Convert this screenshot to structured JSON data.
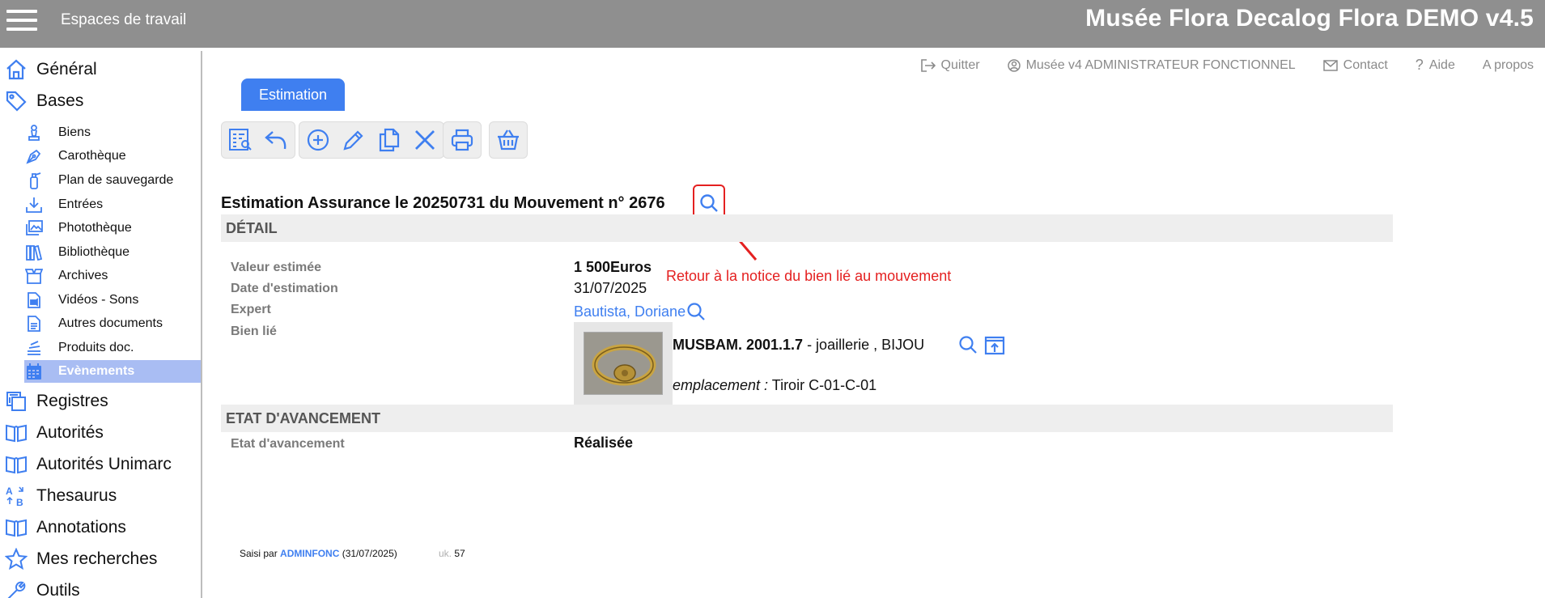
{
  "header": {
    "workspaces_label": "Espaces de travail",
    "app_title": "Musée Flora Decalog Flora DEMO v4.5"
  },
  "sidebar": {
    "main_top": [
      {
        "label": "Général",
        "icon": "home-icon"
      },
      {
        "label": "Bases",
        "icon": "tag-icon"
      }
    ],
    "sub_items": [
      {
        "label": "Biens",
        "icon": "statue-icon"
      },
      {
        "label": "Carothèque",
        "icon": "pen-nib-icon"
      },
      {
        "label": "Plan de sauvegarde",
        "icon": "fire-extinguisher-icon"
      },
      {
        "label": "Entrées",
        "icon": "download-icon"
      },
      {
        "label": "Photothèque",
        "icon": "images-icon"
      },
      {
        "label": "Bibliothèque",
        "icon": "books-icon"
      },
      {
        "label": "Archives",
        "icon": "box-open-icon"
      },
      {
        "label": "Vidéos - Sons",
        "icon": "file-video-icon"
      },
      {
        "label": "Autres documents",
        "icon": "file-text-icon"
      },
      {
        "label": "Produits doc.",
        "icon": "stack-icon"
      },
      {
        "label": "Evènements",
        "icon": "calendar-icon",
        "active": true
      }
    ],
    "main_bottom": [
      {
        "label": "Registres",
        "icon": "copy-icon"
      },
      {
        "label": "Autorités",
        "icon": "book-open-icon"
      },
      {
        "label": "Autorités Unimarc",
        "icon": "book-open-icon"
      },
      {
        "label": "Thesaurus",
        "icon": "sort-alpha-icon"
      },
      {
        "label": "Annotations",
        "icon": "book-open-icon"
      },
      {
        "label": "Mes recherches",
        "icon": "star-icon"
      },
      {
        "label": "Outils",
        "icon": "wrench-icon"
      }
    ]
  },
  "toplinks": {
    "quit": "Quitter",
    "user": "Musée v4 ADMINISTRATEUR FONCTIONNEL",
    "contact": "Contact",
    "help": "Aide",
    "about": "A propos"
  },
  "tab": {
    "label": "Estimation"
  },
  "record": {
    "title": "Estimation Assurance le 20250731 du Mouvement n° 2676"
  },
  "sections": {
    "detail": "DÉTAIL",
    "progress": "ETAT D'AVANCEMENT"
  },
  "fields": {
    "valeur_label": "Valeur estimée",
    "valeur_value": "1 500Euros",
    "date_label": "Date d'estimation",
    "date_value": "31/07/2025",
    "expert_label": "Expert",
    "expert_value": "Bautista, Doriane",
    "bien_label": "Bien lié",
    "bien_ref": "MUSBAM. 2001.1.7",
    "bien_desc": " - joaillerie , BIJOU",
    "emplacement_label": "emplacement :",
    "emplacement_value": " Tiroir C-01-C-01",
    "etat_label": "Etat d'avancement",
    "etat_value": "Réalisée"
  },
  "annotation": {
    "text": "Retour à la notice du bien lié au mouvement"
  },
  "footer": {
    "saisi_par": "Saisi par ",
    "user": "ADMINFONC",
    "date": " (31/07/2025)",
    "uk_label": "uk.",
    "uk_value": "57"
  },
  "colors": {
    "accent": "#3f7ff0",
    "topbar": "#8f8f8f",
    "annotation": "#e42020",
    "active_nav": "#a9bdf3"
  }
}
